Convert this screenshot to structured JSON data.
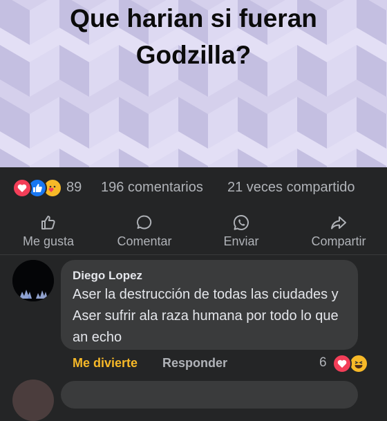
{
  "post": {
    "title_line1": "Que harian si fueran",
    "title_line2": "Godzilla?"
  },
  "stats": {
    "reaction_icons": [
      "heart-icon",
      "like-icon",
      "care-icon"
    ],
    "reaction_count": "89",
    "comments": "196 comentarios",
    "shares": "21 veces compartido"
  },
  "actions": {
    "like": {
      "label": "Me gusta",
      "icon": "thumbs-up-icon"
    },
    "comment": {
      "label": "Comentar",
      "icon": "speech-bubble-icon"
    },
    "send": {
      "label": "Enviar",
      "icon": "whatsapp-icon"
    },
    "share": {
      "label": "Compartir",
      "icon": "share-arrow-icon"
    }
  },
  "comment": {
    "author": "Diego Lopez",
    "text": "Aser la destrucción de todas las ciudades y Aser sufrir ala raza humana por todo lo que an echo",
    "reaction_label": "Me divierte",
    "reply_label": "Responder",
    "reaction_count": "6",
    "reaction_icons": [
      "heart-icon",
      "haha-icon"
    ]
  },
  "colors": {
    "background": "#242526",
    "bubble": "#3a3b3c",
    "text_primary": "#e4e6eb",
    "text_secondary": "#b0b3b8",
    "haha_accent": "#f7b928",
    "like_blue": "#1877f2",
    "love_red": "#f33e58"
  }
}
